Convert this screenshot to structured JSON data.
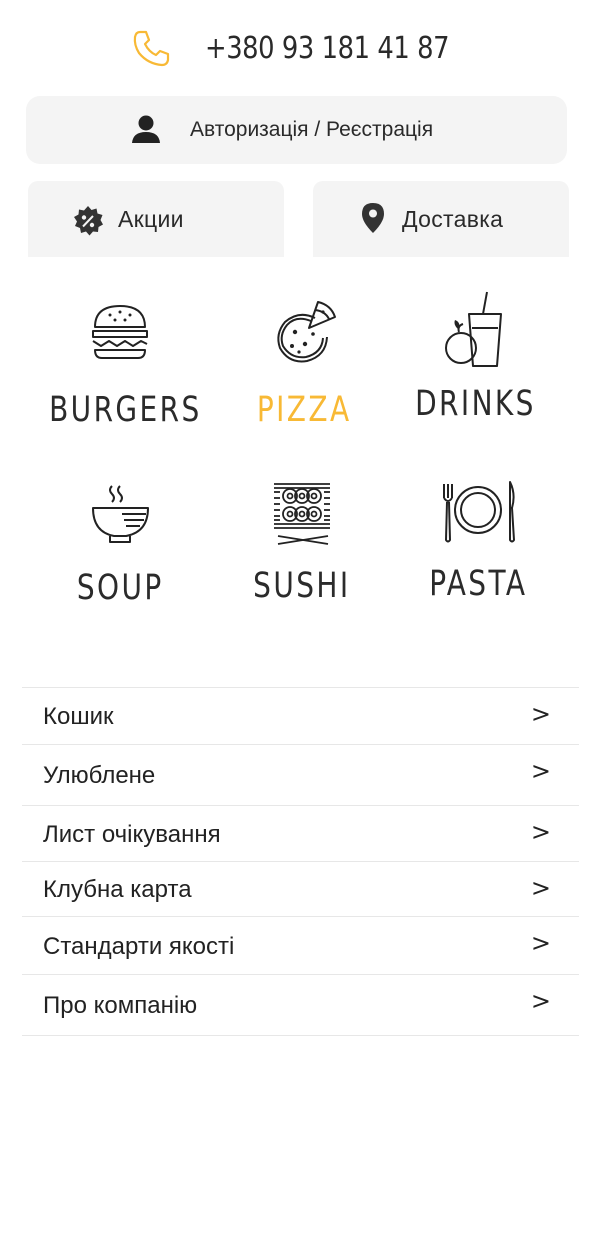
{
  "header": {
    "phone_icon": "phone-icon",
    "phone_number": "+380 93 181 41 87",
    "accent_color": "#f8b935"
  },
  "account": {
    "icon": "user-icon",
    "label": "Авторизація / Реєстрація"
  },
  "quick_links": [
    {
      "icon": "discount-badge-icon",
      "label": "Акции"
    },
    {
      "icon": "map-pin-icon",
      "label": "Доставка"
    }
  ],
  "categories": [
    {
      "icon": "burger-icon",
      "label": "BURGERS",
      "active": false
    },
    {
      "icon": "pizza-icon",
      "label": "PIZZA",
      "active": true
    },
    {
      "icon": "drink-icon",
      "label": "DRINKS",
      "active": false
    },
    {
      "icon": "soup-icon",
      "label": "SOUP",
      "active": false
    },
    {
      "icon": "sushi-icon",
      "label": "SUSHI",
      "active": false
    },
    {
      "icon": "plate-cutlery-icon",
      "label": "PASTA",
      "active": false
    }
  ],
  "menu": {
    "chevron": ">",
    "items": [
      {
        "label": "Кошик"
      },
      {
        "label": "Улюблене"
      },
      {
        "label": "Лист очікування"
      },
      {
        "label": "Клубна карта"
      },
      {
        "label": "Стандарти якості"
      },
      {
        "label": "Про компанію"
      }
    ]
  }
}
